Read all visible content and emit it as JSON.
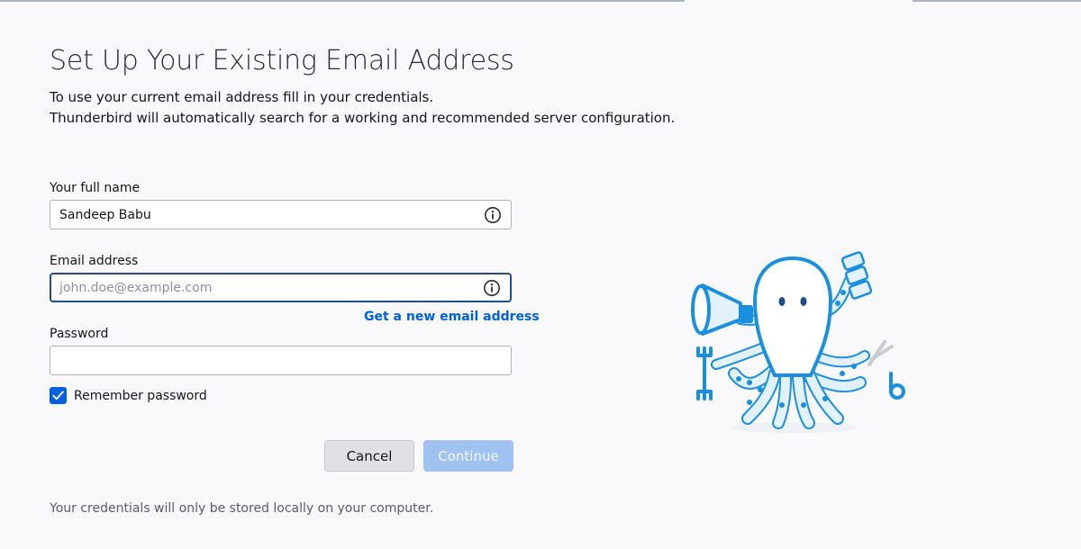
{
  "header": {
    "title": "Set Up Your Existing Email Address",
    "intro_line_1": "To use your current email address fill in your credentials.",
    "intro_line_2": "Thunderbird will automatically search for a working and recommended server configuration."
  },
  "form": {
    "full_name": {
      "label": "Your full name",
      "value": "Sandeep Babu",
      "placeholder": ""
    },
    "email": {
      "label": "Email address",
      "value": "",
      "placeholder": "john.doe@example.com",
      "new_email_link": "Get a new email address"
    },
    "password": {
      "label": "Password",
      "value": "",
      "placeholder": ""
    },
    "remember_password": {
      "label": "Remember password",
      "checked": true
    }
  },
  "buttons": {
    "cancel_label": "Cancel",
    "continue_label": "Continue"
  },
  "footer": {
    "note": "Your credentials will only be stored locally on your computer."
  },
  "icons": {
    "info": "info-circle-icon",
    "checkmark": "checkmark-icon",
    "mascot": "octopus-mascot-illustration"
  },
  "colors": {
    "accent": "#0060df",
    "focus_border": "#1f4d8f",
    "disabled_primary": "#9fc2f0",
    "mascot_stroke": "#1a8fe0",
    "mascot_fill": "#e3f1fd"
  }
}
